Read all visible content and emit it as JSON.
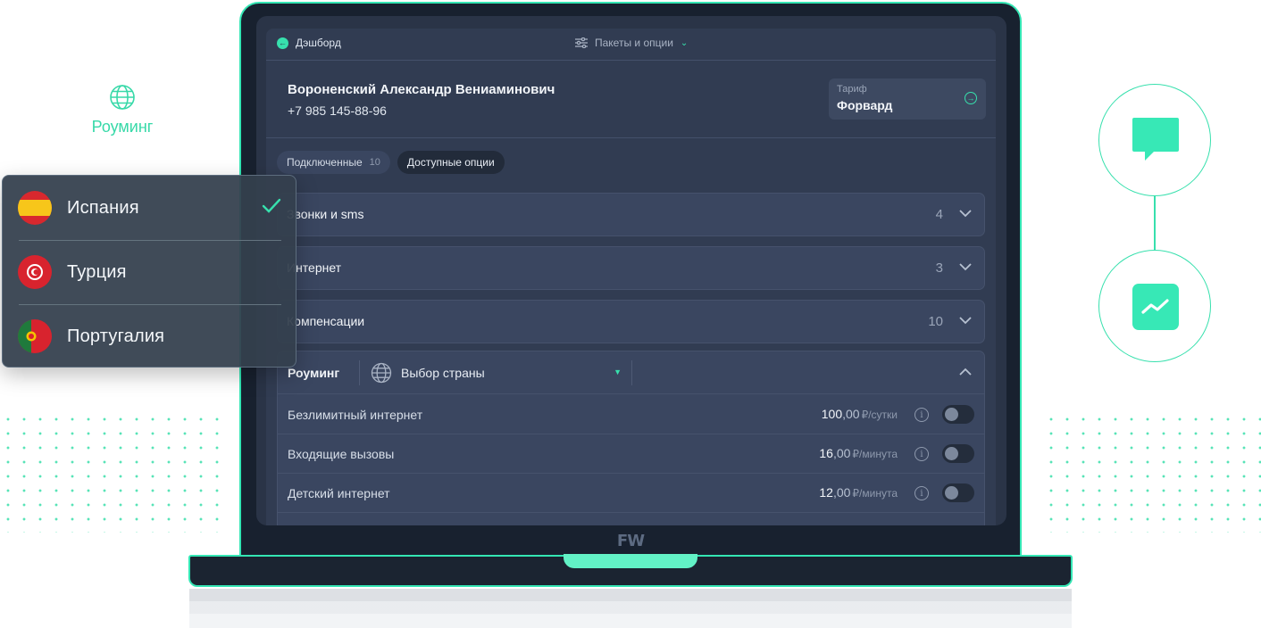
{
  "roaming_badge": {
    "label": "Роуминг",
    "icon": "globe-icon"
  },
  "topbar": {
    "back_label": "Дэшборд",
    "packages_label": "Пакеты и опции",
    "icons": {
      "back": "arrow-left-icon",
      "packages": "sliders-icon",
      "packages_dropdown": "chevron-down-icon"
    }
  },
  "client": {
    "name": "Вороненский Александр Вениаминович",
    "phone": "+7 985 145-88-96",
    "tariff_label": "Тариф",
    "tariff_value": "Форвард"
  },
  "tabs": [
    {
      "label": "Подключенные",
      "count": "10",
      "active": false
    },
    {
      "label": "Доступные опции",
      "active": true
    }
  ],
  "sections": [
    {
      "title": "Звонки и sms",
      "count": "4"
    },
    {
      "title": "Интернет",
      "count": "3"
    },
    {
      "title": "Компенсации",
      "count": "10"
    }
  ],
  "roaming": {
    "title": "Роуминг",
    "country_select_placeholder": "Выбор страны",
    "options": [
      {
        "name": "Безлимитный интернет",
        "price_int": "100",
        "price_dec": ",00",
        "currency_unit": "₽/сутки",
        "enabled": false
      },
      {
        "name": "Входящие вызовы",
        "price_int": "16",
        "price_dec": ",00",
        "currency_unit": "₽/минута",
        "enabled": false
      },
      {
        "name": "Детский интернет",
        "price_int": "12",
        "price_dec": ",00",
        "currency_unit": "₽/минута",
        "enabled": false
      }
    ]
  },
  "countries": [
    {
      "name": "Испания",
      "flag": "spain-flag-icon",
      "selected": true
    },
    {
      "name": "Турция",
      "flag": "turkey-flag-icon",
      "selected": false
    },
    {
      "name": "Португалия",
      "flag": "portugal-flag-icon",
      "selected": false
    }
  ],
  "brand_mark": "FW",
  "side_icons": [
    "chat-bubble-icon",
    "trend-chart-icon"
  ],
  "colors": {
    "accent": "#37e0ad",
    "screen_bg": "#2a3447",
    "panel_bg": "#3a4660"
  }
}
